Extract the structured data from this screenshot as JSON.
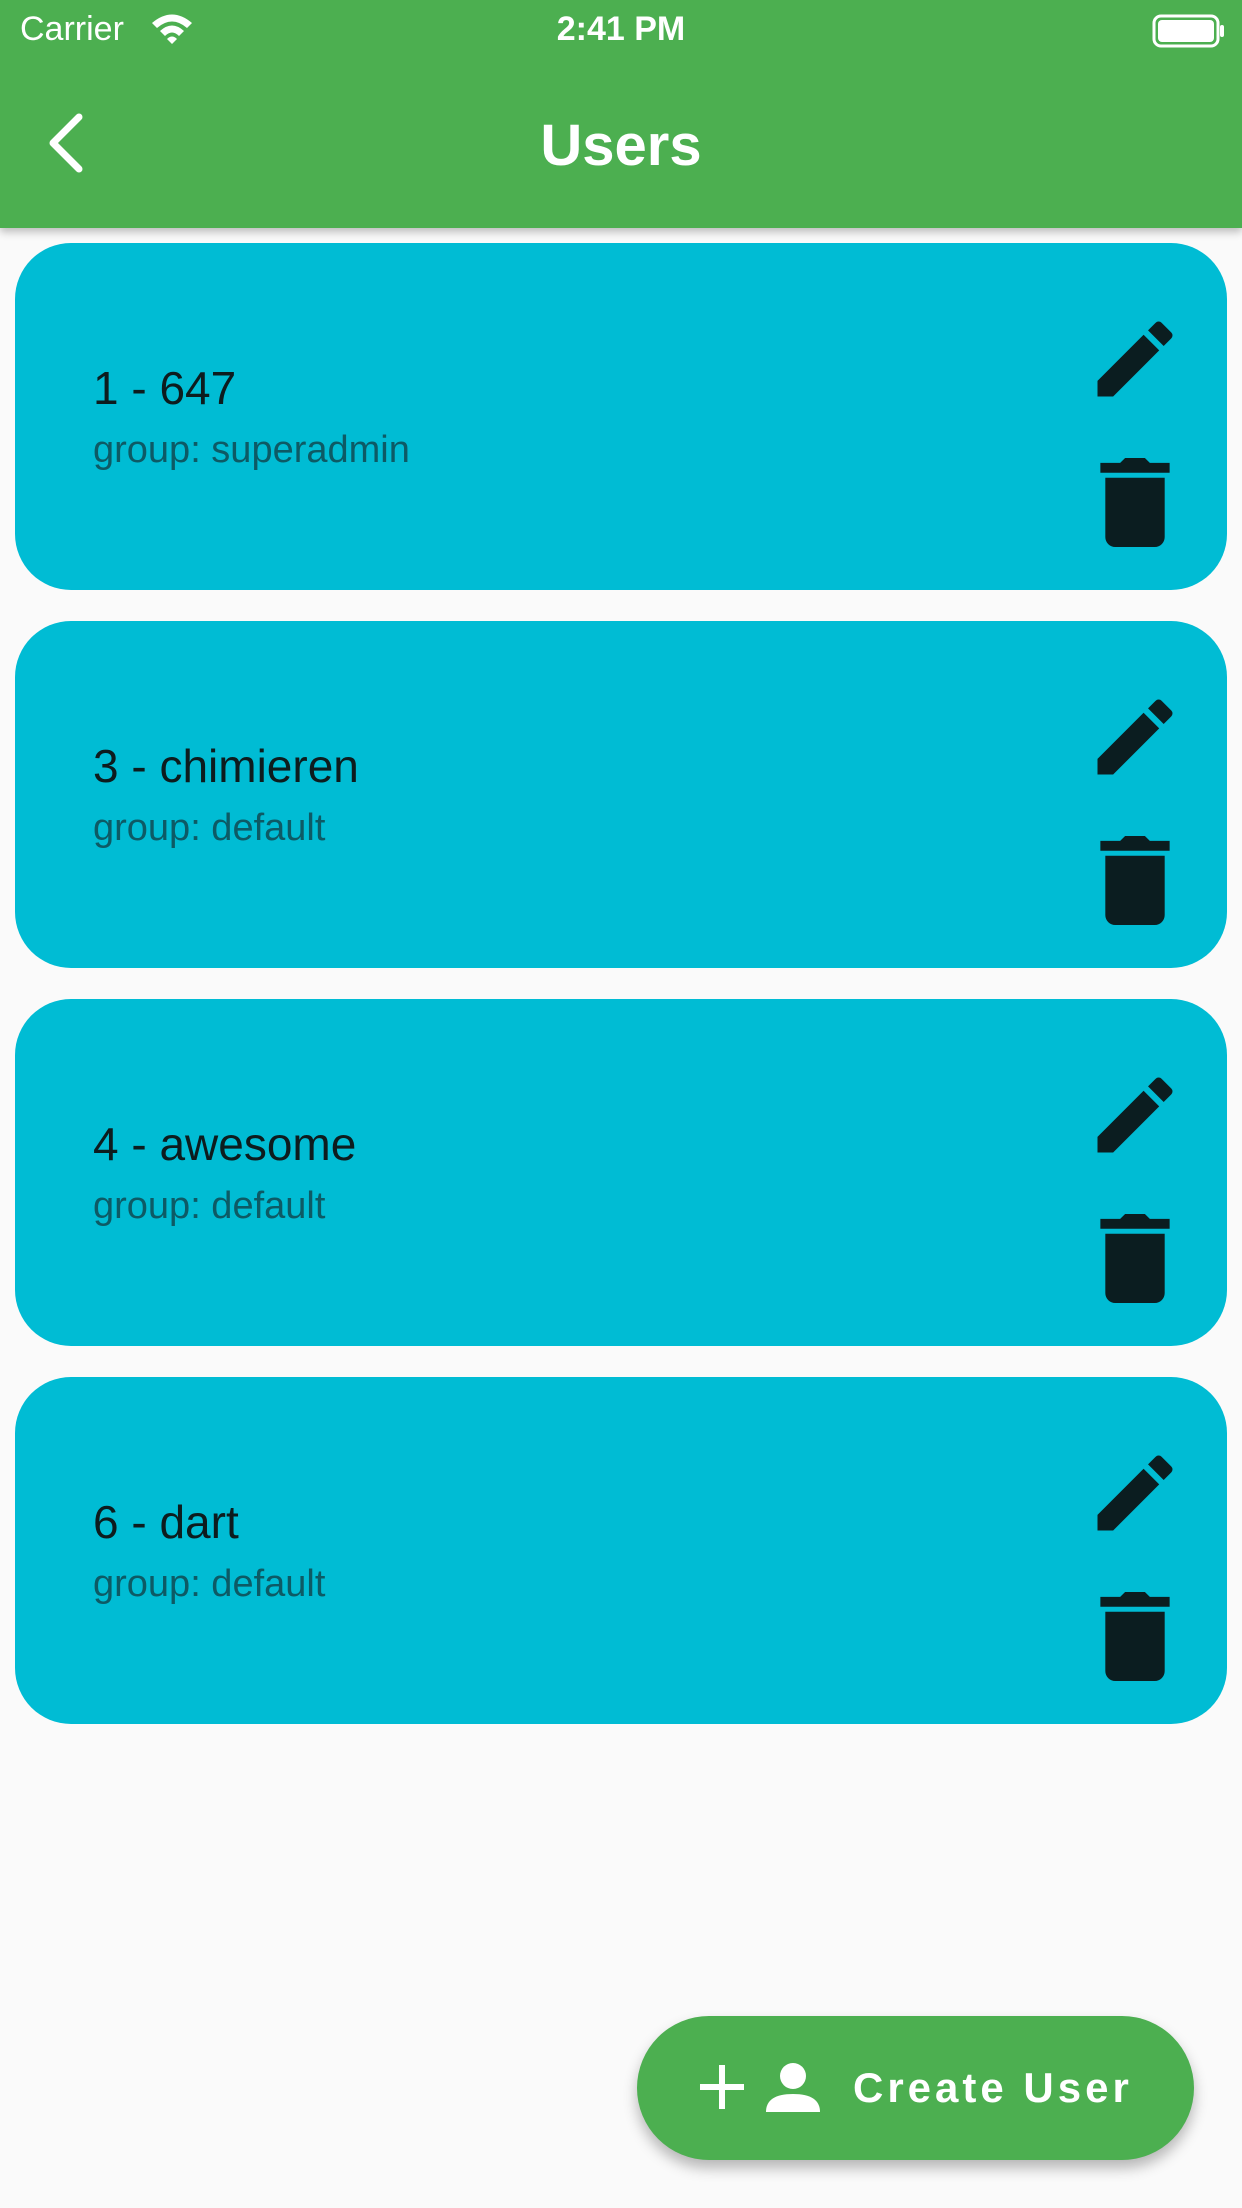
{
  "status_bar": {
    "carrier": "Carrier",
    "time": "2:41 PM"
  },
  "app_bar": {
    "title": "Users",
    "color": "#4caf50"
  },
  "users": [
    {
      "name": "1 - 647",
      "group": "group: superadmin"
    },
    {
      "name": "3 - chimieren",
      "group": "group: default"
    },
    {
      "name": "4 - awesome",
      "group": "group: default"
    },
    {
      "name": "6 - dart",
      "group": "group: default"
    }
  ],
  "card_color": "#00bcd4",
  "fab": {
    "label": "Create User",
    "icons": [
      "plus-icon",
      "person-icon"
    ]
  }
}
